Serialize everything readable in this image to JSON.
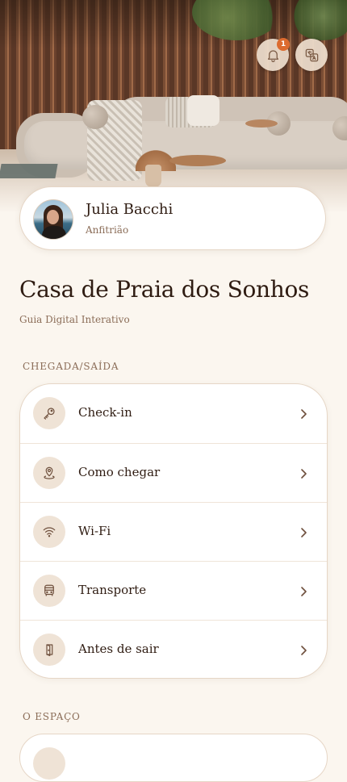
{
  "header": {
    "notifications_count": "1"
  },
  "host": {
    "name": "Julia Bacchi",
    "role": "Anfitrião"
  },
  "property": {
    "title": "Casa de Praia dos Sonhos",
    "subtitle": "Guia Digital Interativo"
  },
  "sections": [
    {
      "title": "CHEGADA/SAÍDA",
      "items": [
        {
          "label": "Check-in",
          "icon": "key-icon"
        },
        {
          "label": "Como chegar",
          "icon": "map-pin-icon"
        },
        {
          "label": "Wi-Fi",
          "icon": "wifi-icon"
        },
        {
          "label": "Transporte",
          "icon": "bus-icon"
        },
        {
          "label": "Antes de sair",
          "icon": "door-exit-icon"
        }
      ]
    },
    {
      "title": "O ESPAÇO"
    }
  ],
  "colors": {
    "background": "#fbf6ef",
    "accent_badge": "#dc6b2f",
    "icon_circle": "#efe3d6",
    "text_primary": "#2f1c12",
    "text_secondary": "#8b6d58"
  }
}
